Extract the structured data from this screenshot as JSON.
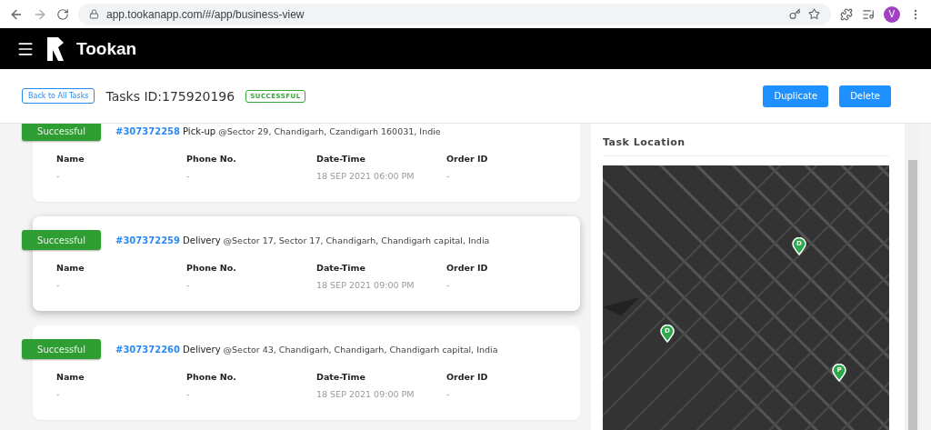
{
  "browser": {
    "url": "app.tookanapp.com/#/app/business-view",
    "profile_initial": "V"
  },
  "header": {
    "brand": "Tookan"
  },
  "subheader": {
    "back_button": "Back to All Tasks",
    "title": "Tasks ID:175920196",
    "status": "SUCCESSFUL",
    "actions": [
      "Duplicate",
      "Delete"
    ]
  },
  "tasks": [
    {
      "status": "Successful",
      "id": "#307372258",
      "type": "Pick-up",
      "address": "@Sector 29, Chandigarh, Czandigarh 160031, Indie",
      "raised": false,
      "fields": [
        {
          "label": "Name",
          "value": "-"
        },
        {
          "label": "Phone No.",
          "value": "-"
        },
        {
          "label": "Date-Time",
          "value": "18 SEP 2021 06:00 PM"
        },
        {
          "label": "Order ID",
          "value": "-"
        }
      ]
    },
    {
      "status": "Successful",
      "id": "#307372259",
      "type": "Delivery",
      "address": "@Sector 17, Sector 17, Chandigarh, Chandigarh capital, India",
      "raised": true,
      "fields": [
        {
          "label": "Name",
          "value": "-"
        },
        {
          "label": "Phone No.",
          "value": "-"
        },
        {
          "label": "Date-Time",
          "value": "18 SEP 2021 09:00 PM"
        },
        {
          "label": "Order ID",
          "value": "-"
        }
      ]
    },
    {
      "status": "Successful",
      "id": "#307372260",
      "type": "Delivery",
      "address": "@Sector 43, Chandigarh, Chandigarh, Chandigarh capital, India",
      "raised": false,
      "fields": [
        {
          "label": "Name",
          "value": "-"
        },
        {
          "label": "Phone No.",
          "value": "-"
        },
        {
          "label": "Date-Time",
          "value": "18 SEP 2021 09:00 PM"
        },
        {
          "label": "Order ID",
          "value": "-"
        }
      ]
    }
  ],
  "location": {
    "title": "Task Location",
    "markers": [
      {
        "label": "D"
      },
      {
        "label": "D"
      },
      {
        "label": "P"
      }
    ]
  }
}
